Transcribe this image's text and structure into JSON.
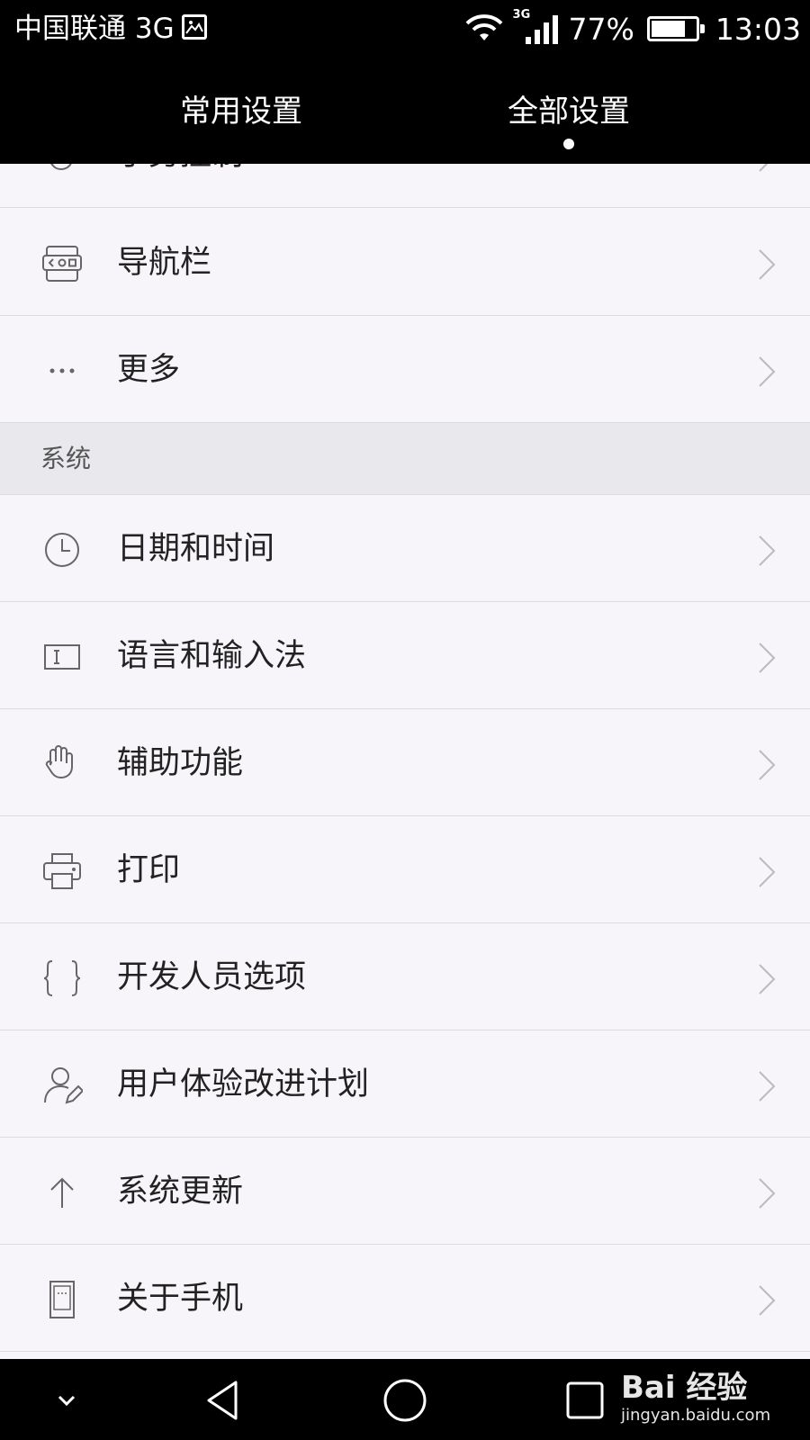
{
  "status_bar": {
    "carrier": "中国联通 3G",
    "network_badge": "3G",
    "battery_percent": "77%",
    "battery_level": 0.77,
    "time": "13:03"
  },
  "tabs": [
    {
      "label": "常用设置",
      "selected": false
    },
    {
      "label": "全部设置",
      "selected": true
    }
  ],
  "settings_list": {
    "partial_item": {
      "label": "手势控制",
      "icon": "hand-icon"
    },
    "items_top": [
      {
        "label": "导航栏",
        "icon": "navigation-bar-icon"
      },
      {
        "label": "更多",
        "icon": "more-dots-icon"
      }
    ],
    "section_title": "系统",
    "items_system": [
      {
        "label": "日期和时间",
        "icon": "clock-icon"
      },
      {
        "label": "语言和输入法",
        "icon": "keyboard-icon"
      },
      {
        "label": "辅助功能",
        "icon": "hand-icon"
      },
      {
        "label": "打印",
        "icon": "printer-icon"
      },
      {
        "label": "开发人员选项",
        "icon": "braces-icon"
      },
      {
        "label": "用户体验改进计划",
        "icon": "user-edit-icon"
      },
      {
        "label": "系统更新",
        "icon": "arrow-up-icon"
      },
      {
        "label": "关于手机",
        "icon": "phone-icon"
      }
    ]
  },
  "watermark": {
    "line1": "Bai 经验",
    "line2": "jingyan.baidu.com"
  },
  "colors": {
    "list_background": "#f7f5f9",
    "section_background": "#e9e8ed",
    "divider": "#dcdcdc",
    "bar_background": "#000000"
  }
}
